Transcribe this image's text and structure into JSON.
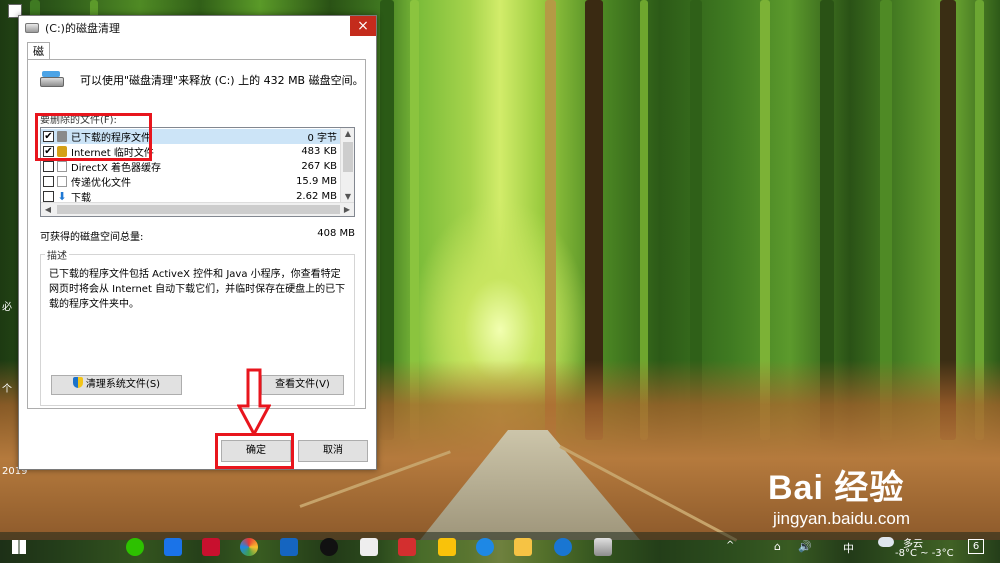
{
  "window": {
    "title": "(C:)的磁盘清理",
    "close_glyph": "×",
    "tab_label": "磁盘清理"
  },
  "dialog": {
    "header_text": "可以使用\"磁盘清理\"来释放 (C:) 上的 432 MB 磁盘空间。",
    "files_label": "要删除的文件(F):",
    "files": [
      {
        "name": "已下载的程序文件",
        "size": "0 字节",
        "checked": true,
        "selected": true,
        "icon": "folder-icon"
      },
      {
        "name": "Internet 临时文件",
        "size": "483 KB",
        "checked": true,
        "selected": false,
        "icon": "lock-icon"
      },
      {
        "name": "DirectX 着色器缓存",
        "size": "267 KB",
        "checked": false,
        "selected": false,
        "icon": "file-icon"
      },
      {
        "name": "传递优化文件",
        "size": "15.9 MB",
        "checked": false,
        "selected": false,
        "icon": "file-icon"
      },
      {
        "name": "下载",
        "size": "2.62 MB",
        "checked": false,
        "selected": false,
        "icon": "download-arrow-icon"
      }
    ],
    "total_label": "可获得的磁盘空间总量:",
    "total_value": "408 MB",
    "description_title": "描述",
    "description_text": "已下载的程序文件包括 ActiveX 控件和 Java 小程序，你查看特定网页时将会从 Internet 自动下载它们，并临时保存在硬盘上的已下载的程序文件夹中。",
    "clean_system_button": "清理系统文件(S)",
    "view_files_button": "查看文件(V)",
    "ok_button": "确定",
    "cancel_button": "取消"
  },
  "desktop": {
    "edge_labels": [
      "必",
      "个",
      "2019"
    ]
  },
  "taskbar": {
    "input_method": "中",
    "weather": "多云",
    "temperature": "-8°C ~ -3°C",
    "notification_count": "6"
  },
  "watermark": {
    "main": "Bai 经验",
    "sub": "jingyan.baidu.com"
  },
  "colors": {
    "annotation_red": "#e8151d",
    "selection_blue": "#cce4f7",
    "close_red": "#c42b1c"
  }
}
